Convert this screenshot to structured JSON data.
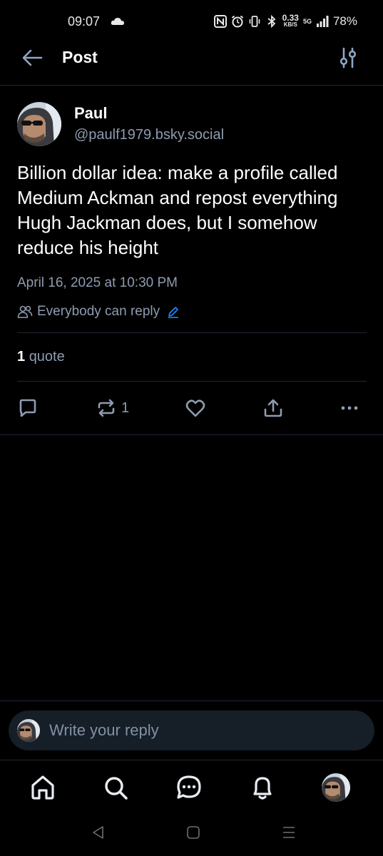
{
  "status_bar": {
    "time": "09:07",
    "speed_value": "0.33",
    "speed_unit": "KB/S",
    "network": "5G",
    "battery": "78%",
    "icons": [
      "cloud-icon",
      "nfc-icon",
      "alarm-icon",
      "vibrate-icon",
      "bluetooth-icon",
      "signal-icon"
    ]
  },
  "header": {
    "title": "Post",
    "back_icon": "arrow-left-icon",
    "options_icon": "sliders-icon"
  },
  "post": {
    "author_name": "Paul",
    "author_handle": "@paulf1979.bsky.social",
    "text": "Billion dollar idea: make a profile called Medium Ackman and repost everything Hugh Jackman does, but I somehow reduce his height",
    "date": "April 16, 2025 at 10:30 PM",
    "reply_setting": "Everybody can reply",
    "quote_count": "1",
    "quote_label": "quote",
    "actions": {
      "reply_icon": "comment-icon",
      "repost_icon": "repost-icon",
      "repost_count": "1",
      "like_icon": "heart-icon",
      "share_icon": "share-icon",
      "more_icon": "more-icon"
    }
  },
  "composer": {
    "placeholder": "Write your reply"
  },
  "bottom_nav": {
    "items": [
      "home-icon",
      "search-icon",
      "chat-icon",
      "bell-icon",
      "profile-avatar"
    ]
  },
  "colors": {
    "background": "#000000",
    "muted_text": "#8f9bb0",
    "divider": "#1f2833",
    "composer_bg": "#161e27",
    "accent": "#208bfe"
  }
}
